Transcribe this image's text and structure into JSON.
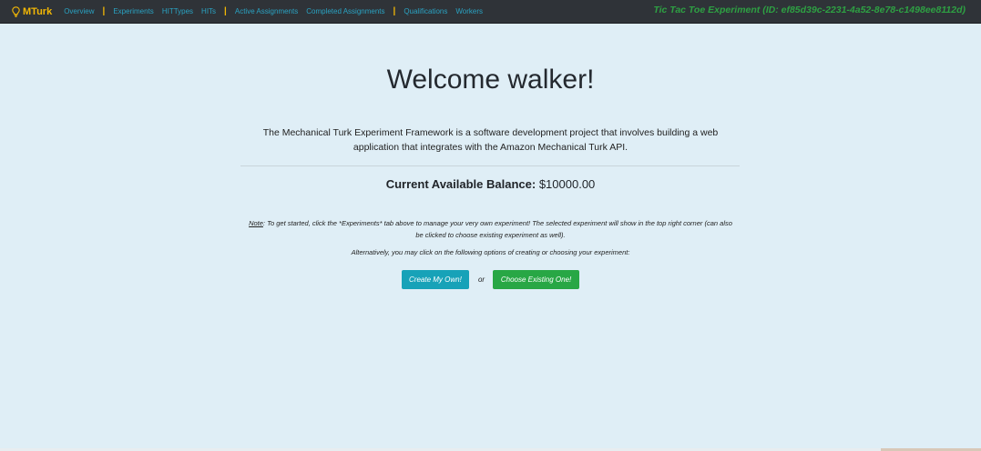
{
  "navbar": {
    "brand": "MTurk",
    "links": [
      {
        "label": "Overview"
      },
      {
        "label": "Experiments"
      },
      {
        "label": "HITTypes"
      },
      {
        "label": "HITs"
      },
      {
        "label": "Active Assignments"
      },
      {
        "label": "Completed Assignments"
      },
      {
        "label": "Qualifications"
      },
      {
        "label": "Workers"
      }
    ],
    "separator": "|",
    "experiment_title": "Tic Tac Toe Experiment (ID: ef85d39c-2231-4a52-8e78-c1498ee8112d)"
  },
  "main": {
    "welcome": "Welcome walker!",
    "intro": "The Mechanical Turk Experiment Framework is a software development project that involves building a web application that integrates with the Amazon Mechanical Turk API.",
    "balance_label": "Current Available Balance:",
    "balance_value": "$10000.00",
    "note_label": "Note",
    "note_text": ": To get started, click the *Experiments* tab above to manage your very own experiment! The selected experiment will show in the top right corner (can also be clicked to choose existing experiment as well).",
    "alternative_text": "Alternatively, you may click on the following options of creating or choosing your experiment:",
    "create_button": "Create My Own!",
    "or_text": "or",
    "choose_button": "Choose Existing One!"
  },
  "colors": {
    "navbar_bg": "#2f3338",
    "brand": "#f2b705",
    "nav_link": "#2aa3c3",
    "experiment_title": "#2ea043",
    "page_bg": "#dfeef6",
    "create_button": "#17a2b8",
    "choose_button": "#28a745"
  },
  "icons": {
    "brand_icon": "lightbulb-icon"
  }
}
